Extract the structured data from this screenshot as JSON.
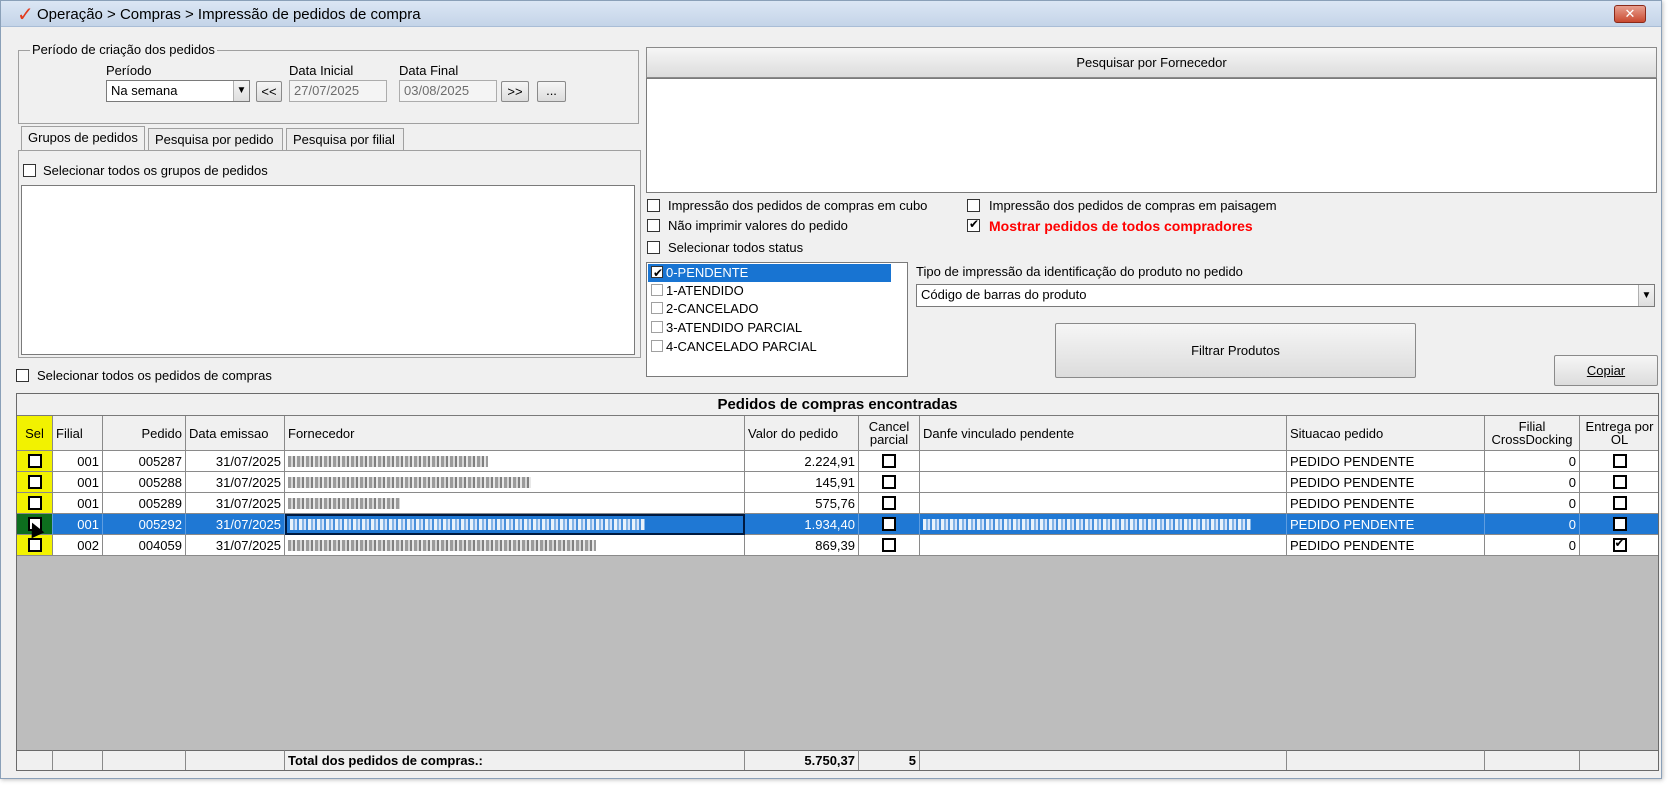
{
  "window": {
    "title": "Operação > Compras > Impressão de pedidos de compra",
    "close_label": "✕"
  },
  "periodo_group": {
    "legend": "Período de criação dos pedidos",
    "periodo_label": "Período",
    "periodo_value": "Na semana",
    "data_inicial_label": "Data Inicial",
    "data_inicial_value": "27/07/2025",
    "data_final_label": "Data Final",
    "data_final_value": "03/08/2025",
    "prev_label": "<<",
    "next_label": ">>",
    "more_label": "..."
  },
  "tabs": [
    {
      "label": "Grupos de pedidos",
      "active": true
    },
    {
      "label": "Pesquisa por pedido",
      "active": false
    },
    {
      "label": "Pesquisa por filial",
      "active": false
    }
  ],
  "grupos": {
    "select_all_label": "Selecionar todos os grupos de pedidos"
  },
  "select_all_pedidos_label": "Selecionar todos os pedidos de compras",
  "fornecedor": {
    "header_label": "Pesquisar por Fornecedor"
  },
  "options": {
    "cubo_label": "Impressão dos pedidos de compras em cubo",
    "paisagem_label": "Impressão dos pedidos de compras em paisagem",
    "nao_imprimir_label": "Não imprimir valores do pedido",
    "mostrar_todos_label": "Mostrar pedidos de todos compradores",
    "selecionar_status_label": "Selecionar todos status",
    "accent_red": "#ff0000"
  },
  "status_list": [
    {
      "label": "0-PENDENTE",
      "checked": true,
      "selected": true
    },
    {
      "label": "1-ATENDIDO",
      "checked": false,
      "selected": false
    },
    {
      "label": "2-CANCELADO",
      "checked": false,
      "selected": false
    },
    {
      "label": "3-ATENDIDO PARCIAL",
      "checked": false,
      "selected": false
    },
    {
      "label": "4-CANCELADO PARCIAL",
      "checked": false,
      "selected": false
    }
  ],
  "tipo_impressao": {
    "label": "Tipo de impressão da identificação do produto no pedido",
    "value": "Código de barras do produto"
  },
  "buttons": {
    "filtrar_label": "Filtrar Produtos",
    "copiar_label": "Copiar"
  },
  "grid": {
    "caption": "Pedidos de compras encontradas",
    "headers": {
      "sel": "Sel",
      "filial": "Filial",
      "pedido": "Pedido",
      "data": "Data emissao",
      "fornecedor": "Fornecedor",
      "valor": "Valor do pedido",
      "cancel": "Cancel parcial",
      "danfe": "Danfe vinculado pendente",
      "situacao": "Situacao pedido",
      "crossdocking": "Filial CrossDocking",
      "entrega": "Entrega por OL"
    },
    "rows": [
      {
        "filial": "001",
        "pedido": "005287",
        "data": "31/07/2025",
        "valor": "2.224,91",
        "situacao": "PEDIDO PENDENTE",
        "crossdocking": "0",
        "entrega": false,
        "selected": false
      },
      {
        "filial": "001",
        "pedido": "005288",
        "data": "31/07/2025",
        "valor": "145,91",
        "situacao": "PEDIDO PENDENTE",
        "crossdocking": "0",
        "entrega": false,
        "selected": false
      },
      {
        "filial": "001",
        "pedido": "005289",
        "data": "31/07/2025",
        "valor": "575,76",
        "situacao": "PEDIDO PENDENTE",
        "crossdocking": "0",
        "entrega": false,
        "selected": false
      },
      {
        "filial": "001",
        "pedido": "005292",
        "data": "31/07/2025",
        "valor": "1.934,40",
        "situacao": "PEDIDO PENDENTE",
        "crossdocking": "0",
        "entrega": false,
        "selected": true
      },
      {
        "filial": "002",
        "pedido": "004059",
        "data": "31/07/2025",
        "valor": "869,39",
        "situacao": "PEDIDO PENDENTE",
        "crossdocking": "0",
        "entrega": true,
        "selected": false
      }
    ],
    "footer": {
      "label": "Total dos pedidos de compras.:",
      "total": "5.750,37",
      "count": "5"
    },
    "selection_color": "#1f78d4",
    "sel_column_color": "#f2f200"
  }
}
